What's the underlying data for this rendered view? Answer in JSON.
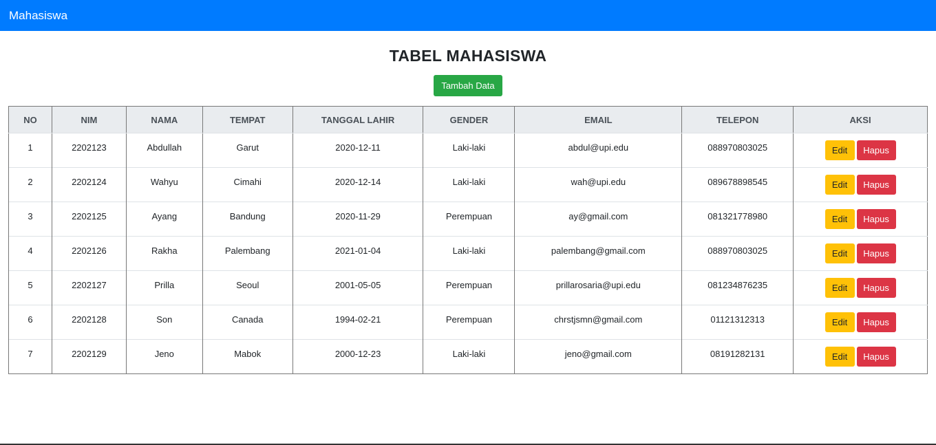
{
  "navbar": {
    "brand": "Mahasiswa"
  },
  "page": {
    "title": "TABEL MAHASISWA",
    "add_button": "Tambah Data"
  },
  "table": {
    "headers": [
      "NO",
      "NIM",
      "NAMA",
      "TEMPAT",
      "TANGGAL LAHIR",
      "GENDER",
      "EMAIL",
      "TELEPON",
      "AKSI"
    ],
    "rows": [
      {
        "no": "1",
        "nim": "2202123",
        "nama": "Abdullah",
        "tempat": "Garut",
        "tanggal": "2020-12-11",
        "gender": "Laki-laki",
        "email": "abdul@upi.edu",
        "telepon": "088970803025"
      },
      {
        "no": "2",
        "nim": "2202124",
        "nama": "Wahyu",
        "tempat": "Cimahi",
        "tanggal": "2020-12-14",
        "gender": "Laki-laki",
        "email": "wah@upi.edu",
        "telepon": "089678898545"
      },
      {
        "no": "3",
        "nim": "2202125",
        "nama": "Ayang",
        "tempat": "Bandung",
        "tanggal": "2020-11-29",
        "gender": "Perempuan",
        "email": "ay@gmail.com",
        "telepon": "081321778980"
      },
      {
        "no": "4",
        "nim": "2202126",
        "nama": "Rakha",
        "tempat": "Palembang",
        "tanggal": "2021-01-04",
        "gender": "Laki-laki",
        "email": "palembang@gmail.com",
        "telepon": "088970803025"
      },
      {
        "no": "5",
        "nim": "2202127",
        "nama": "Prilla",
        "tempat": "Seoul",
        "tanggal": "2001-05-05",
        "gender": "Perempuan",
        "email": "prillarosaria@upi.edu",
        "telepon": "081234876235"
      },
      {
        "no": "6",
        "nim": "2202128",
        "nama": "Son",
        "tempat": "Canada",
        "tanggal": "1994-02-21",
        "gender": "Perempuan",
        "email": "chrstjsmn@gmail.com",
        "telepon": "01121312313"
      },
      {
        "no": "7",
        "nim": "2202129",
        "nama": "Jeno",
        "tempat": "Mabok",
        "tanggal": "2000-12-23",
        "gender": "Laki-laki",
        "email": "jeno@gmail.com",
        "telepon": "08191282131"
      }
    ],
    "edit_label": "Edit",
    "delete_label": "Hapus"
  },
  "colors": {
    "navbar": "#007bff",
    "success": "#28a745",
    "warning": "#ffc107",
    "danger": "#dc3545",
    "header_bg": "#e9ecef"
  }
}
